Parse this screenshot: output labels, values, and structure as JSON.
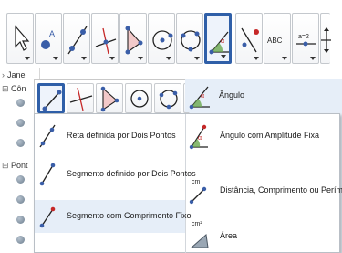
{
  "left_panel": {
    "rows": [
      {
        "label": "Jane",
        "type": "header"
      },
      {
        "label": "Côn",
        "type": "group"
      },
      {
        "label": "Pont",
        "type": "group"
      }
    ]
  },
  "toolbar": {
    "tools": [
      {
        "name": "move-tool",
        "icon": "arrow-cursor-icon"
      },
      {
        "name": "point-tool",
        "icon": "point-icon",
        "letter": "A"
      },
      {
        "name": "line-tool",
        "icon": "line-two-points-icon"
      },
      {
        "name": "perpendicular-tool",
        "icon": "perpendicular-icon"
      },
      {
        "name": "polygon-tool",
        "icon": "polygon-icon"
      },
      {
        "name": "circle-tool",
        "icon": "circle-center-icon"
      },
      {
        "name": "circle-three-points-tool",
        "icon": "circle-three-points-icon"
      },
      {
        "name": "angle-tool",
        "icon": "angle-icon",
        "active": true
      },
      {
        "name": "reflect-tool",
        "icon": "reflect-icon"
      },
      {
        "name": "text-tool",
        "icon": "text-icon",
        "label": "ABC"
      },
      {
        "name": "slider-tool",
        "icon": "slider-icon",
        "label": "a=2"
      },
      {
        "name": "move-view-tool",
        "icon": "move-graphics-icon"
      }
    ]
  },
  "subbar": {
    "tools": [
      {
        "name": "segment-tool",
        "icon": "segment-icon",
        "selected": true
      },
      {
        "name": "perpendicular-tool",
        "icon": "perpendicular-icon"
      },
      {
        "name": "polygon-tool",
        "icon": "polygon-icon"
      },
      {
        "name": "circle-tool",
        "icon": "circle-icon"
      },
      {
        "name": "circle-three-points-tool",
        "icon": "circle-three-points-icon"
      },
      {
        "name": "angle-tool",
        "icon": "angle-icon"
      }
    ]
  },
  "menu": {
    "left_items": [
      {
        "label": "Reta definida por Dois Pontos",
        "icon": "line-two-points-icon"
      },
      {
        "label": "Segmento definido por Dois Pontos",
        "icon": "segment-two-points-icon"
      },
      {
        "label": "Segmento com Comprimento Fixo",
        "icon": "segment-fixed-length-icon",
        "selected": true
      }
    ],
    "right_items": [
      {
        "label": "Ângulo",
        "icon": "angle-icon",
        "selected": true
      },
      {
        "label": "Ângulo com Amplitude Fixa",
        "icon": "angle-fixed-icon"
      },
      {
        "label": "Distância, Comprimento ou Perímetro",
        "icon": "distance-icon",
        "badge": "cm"
      },
      {
        "label": "Área",
        "icon": "area-icon",
        "badge": "cm²"
      }
    ]
  },
  "colors": {
    "active_border": "#2f5fa8",
    "selection_bg": "#e6eef8",
    "point_blue": "#3a5ea8",
    "point_red": "#c62828"
  }
}
